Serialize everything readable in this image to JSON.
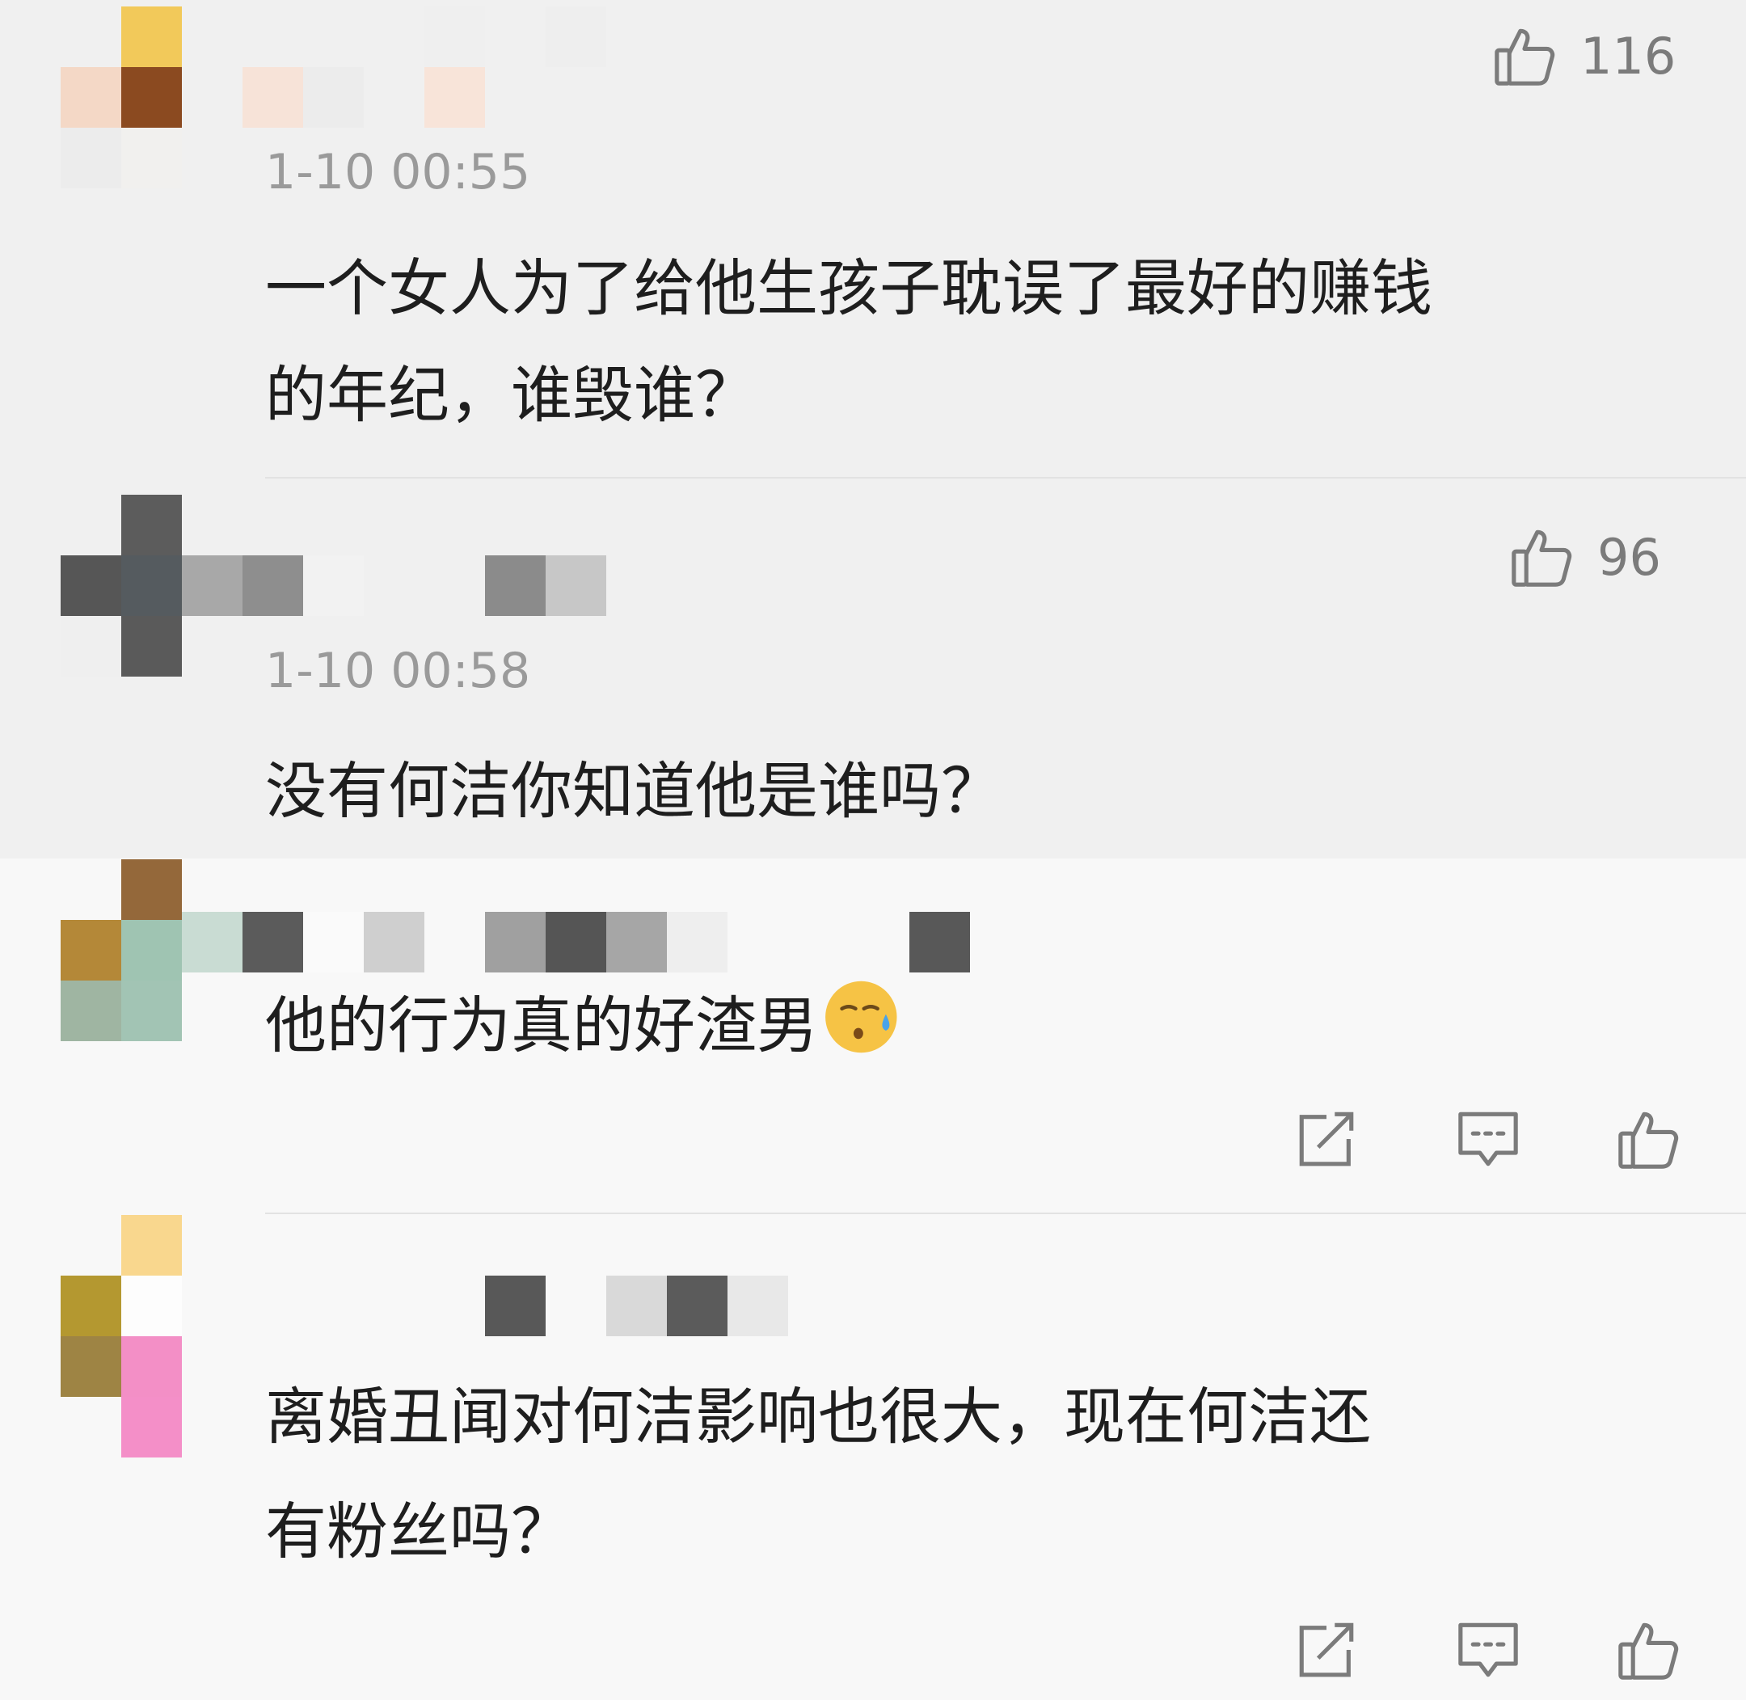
{
  "comments": [
    {
      "time": "1-10 00:55",
      "text_lines": [
        "一个女人为了给他生孩子耽误了最好的赚钱",
        "的年纪，谁毁谁？"
      ],
      "likes": "116"
    },
    {
      "time": "1-10 00:58",
      "text_lines": [
        "没有何洁你知道他是谁吗？"
      ],
      "likes": "96"
    },
    {
      "text_lines": [
        "他的行为真的好渣男"
      ],
      "emoji": "sweat-emoji"
    },
    {
      "text_lines": [
        "离婚丑闻对何洁影响也很大，现在何洁还",
        "有粉丝吗？"
      ]
    }
  ],
  "icons": {
    "like": "thumbs-up-icon",
    "share": "share-icon",
    "reply": "comment-icon"
  },
  "colors": {
    "reply_bg": "#f0f0f0",
    "page_bg": "#f8f8f8",
    "icon": "#7b7b7b",
    "text": "#1e1e1e",
    "time": "#9a9a9a"
  }
}
